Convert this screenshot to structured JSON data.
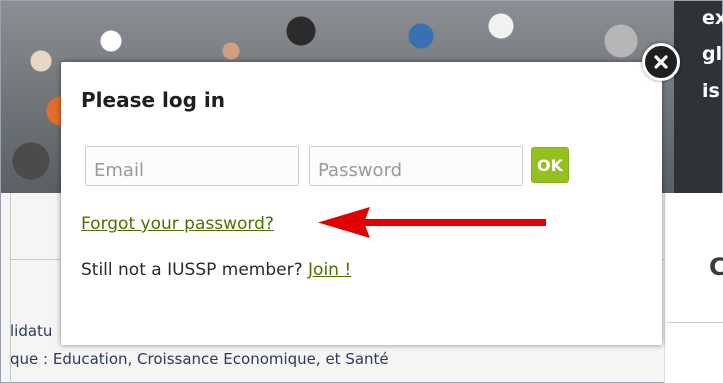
{
  "background": {
    "right_panel_text_lines": [
      "ex",
      "gl",
      "is"
    ],
    "right_panel_heading": "C",
    "line1": "lidatu",
    "line2": "que : Education, Croissance Economique, et Santé"
  },
  "modal": {
    "title": "Please log in",
    "email_placeholder": "Email",
    "password_placeholder": "Password",
    "ok_label": "OK",
    "forgot_link": "Forgot your password?",
    "member_prompt": "Still not a IUSSP member?",
    "join_link": "Join !",
    "close_icon": "close-icon"
  },
  "colors": {
    "accent_green": "#95c11f",
    "link_green": "#4f6f00",
    "arrow_red": "#e10000"
  }
}
